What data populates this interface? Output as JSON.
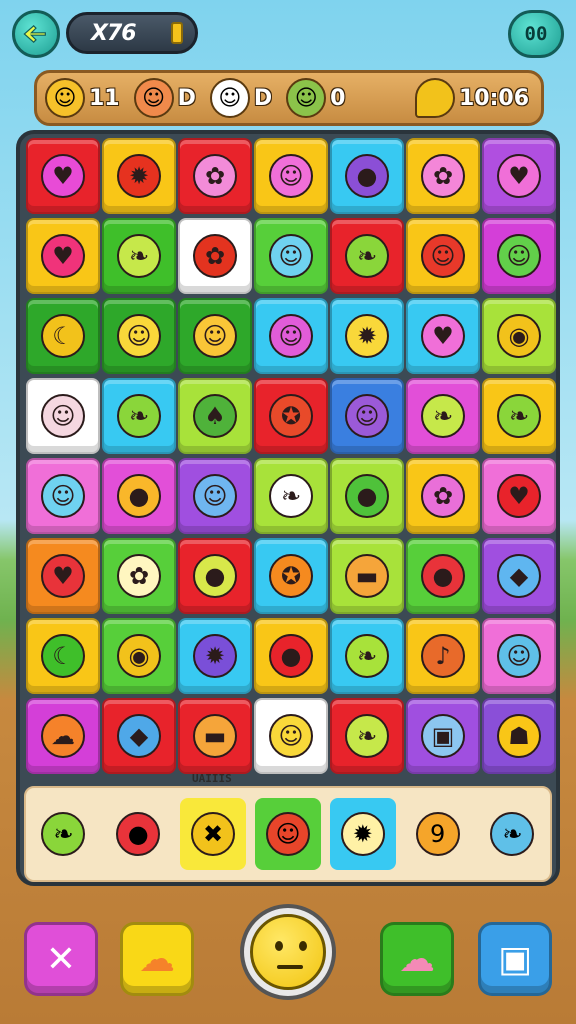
{
  "header": {
    "moves": "X76",
    "pause_label": "00"
  },
  "scorebar": {
    "stats": [
      {
        "icon": "smiley-face-icon",
        "value": "11",
        "color": "#f6c12a"
      },
      {
        "icon": "girl-face-icon",
        "value": "D",
        "color": "#f08a4b"
      },
      {
        "icon": "ghost-icon",
        "value": "D",
        "color": "#ffffff"
      },
      {
        "icon": "turtle-icon",
        "value": "0",
        "color": "#8bc34a"
      }
    ],
    "timer": {
      "icon": "banana-icon",
      "value": "10:06",
      "color": "#f2c21b"
    }
  },
  "board": {
    "rows": [
      [
        {
          "bg": "#e8232b",
          "fg": "#e84bd6",
          "g": "♥"
        },
        {
          "bg": "#f9c617",
          "fg": "#e6321f",
          "g": "✹"
        },
        {
          "bg": "#e8232b",
          "fg": "#f28bd8",
          "g": "✿"
        },
        {
          "bg": "#f9c617",
          "fg": "#f06fd8",
          "g": "☺"
        },
        {
          "bg": "#38c9f2",
          "fg": "#8b4fd6",
          "g": "●"
        },
        {
          "bg": "#f9c617",
          "fg": "#f486d8",
          "g": "✿"
        },
        {
          "bg": "#b04fe0",
          "fg": "#f06fd8",
          "g": "♥"
        }
      ],
      [
        {
          "bg": "#f9c617",
          "fg": "#f0337a",
          "g": "♥"
        },
        {
          "bg": "#3fbf2a",
          "fg": "#c6e84a",
          "g": "❧"
        },
        {
          "bg": "#ffffff",
          "fg": "#e3331f",
          "g": "✿"
        },
        {
          "bg": "#57cf3a",
          "fg": "#6fd2f0",
          "g": "☺"
        },
        {
          "bg": "#e8232b",
          "fg": "#8ad63a",
          "g": "❧"
        },
        {
          "bg": "#f9c617",
          "fg": "#e8392a",
          "g": "☺"
        },
        {
          "bg": "#d43fd8",
          "fg": "#62d04a",
          "g": "☺"
        }
      ],
      [
        {
          "bg": "#2ea82a",
          "fg": "#f2c21b",
          "g": "☾"
        },
        {
          "bg": "#2ea82a",
          "fg": "#f9d83a",
          "g": "☺"
        },
        {
          "bg": "#2ea82a",
          "fg": "#f9c637",
          "g": "☺"
        },
        {
          "bg": "#38c9f2",
          "fg": "#e15cd8",
          "g": "☺"
        },
        {
          "bg": "#38c9f2",
          "fg": "#f9d83a",
          "g": "✹"
        },
        {
          "bg": "#38c9f2",
          "fg": "#f06fd8",
          "g": "♥"
        },
        {
          "bg": "#a8e23a",
          "fg": "#f2c21b",
          "g": "◉"
        }
      ],
      [
        {
          "bg": "#ffffff",
          "fg": "#f5d7e0",
          "g": "☺"
        },
        {
          "bg": "#38c9f2",
          "fg": "#8ad63a",
          "g": "❧"
        },
        {
          "bg": "#a8e23a",
          "fg": "#4fb23a",
          "g": "♠"
        },
        {
          "bg": "#e8232b",
          "fg": "#e84a2a",
          "g": "✪"
        },
        {
          "bg": "#3a7fe0",
          "fg": "#9b5ad8",
          "g": "☺"
        },
        {
          "bg": "#e24fd8",
          "fg": "#c6e84a",
          "g": "❧"
        },
        {
          "bg": "#f9c617",
          "fg": "#8ad63a",
          "g": "❧"
        }
      ],
      [
        {
          "bg": "#f06fd8",
          "fg": "#6fd2f0",
          "g": "☺"
        },
        {
          "bg": "#e24fd8",
          "fg": "#f9b72a",
          "g": "●"
        },
        {
          "bg": "#a04fe0",
          "fg": "#6fb6f0",
          "g": "☺"
        },
        {
          "bg": "#a8e23a",
          "fg": "#ffffff",
          "g": "❧"
        },
        {
          "bg": "#a8e23a",
          "fg": "#4fc23a",
          "g": "●"
        },
        {
          "bg": "#f9c617",
          "fg": "#e96fd8",
          "g": "✿"
        },
        {
          "bg": "#f06fd8",
          "fg": "#e8232b",
          "g": "♥"
        }
      ],
      [
        {
          "bg": "#f58a1f",
          "fg": "#e8333a",
          "g": "♥"
        },
        {
          "bg": "#57cf3a",
          "fg": "#fff6c0",
          "g": "✿"
        },
        {
          "bg": "#e8232b",
          "fg": "#d8e84a",
          "g": "●"
        },
        {
          "bg": "#38c9f2",
          "fg": "#f58a1f",
          "g": "✪"
        },
        {
          "bg": "#a8e23a",
          "fg": "#f5a53a",
          "g": "▬"
        },
        {
          "bg": "#57cf3a",
          "fg": "#e8333a",
          "g": "●"
        },
        {
          "bg": "#a04fe0",
          "fg": "#5fb6f0",
          "g": "◆"
        }
      ],
      [
        {
          "bg": "#f9c617",
          "fg": "#3fbf2a",
          "g": "☾"
        },
        {
          "bg": "#57cf3a",
          "fg": "#f2c21b",
          "g": "◉"
        },
        {
          "bg": "#38c9f2",
          "fg": "#7a4fd8",
          "g": "✹"
        },
        {
          "bg": "#f9c617",
          "fg": "#e8232b",
          "g": "●"
        },
        {
          "bg": "#38c9f2",
          "fg": "#a8e23a",
          "g": "❧"
        },
        {
          "bg": "#f9c617",
          "fg": "#e86a2a",
          "g": "♪"
        },
        {
          "bg": "#f06fd8",
          "fg": "#5fc0e8",
          "g": "☺"
        }
      ],
      [
        {
          "bg": "#d43fd8",
          "fg": "#f5822a",
          "g": "☁"
        },
        {
          "bg": "#e8232b",
          "fg": "#4fa8e8",
          "g": "◆"
        },
        {
          "bg": "#e8232b",
          "fg": "#f5a53a",
          "g": "▬"
        },
        {
          "bg": "#ffffff",
          "fg": "#f9d83a",
          "g": "☺"
        },
        {
          "bg": "#e8232b",
          "fg": "#c6e84a",
          "g": "❧"
        },
        {
          "bg": "#a04fe0",
          "fg": "#8cc6f0",
          "g": "▣"
        },
        {
          "bg": "#8a4fd8",
          "fg": "#f9c617",
          "g": "☗"
        }
      ]
    ],
    "tray_label": "UAIIIS",
    "tray": [
      {
        "bg": "transparent",
        "fg": "#8ad63a",
        "g": "❧"
      },
      {
        "bg": "transparent",
        "fg": "#e8333a",
        "g": "●"
      },
      {
        "bg": "#f9e83a",
        "fg": "#f2c21b",
        "g": "✖"
      },
      {
        "bg": "#57cf3a",
        "fg": "#e8452a",
        "g": "☺"
      },
      {
        "bg": "#38c9f2",
        "fg": "#fff1a6",
        "g": "✹"
      },
      {
        "bg": "transparent",
        "fg": "#f5a52a",
        "g": "9"
      },
      {
        "bg": "transparent",
        "fg": "#5fc0e8",
        "g": "❧"
      }
    ]
  },
  "bottom": {
    "buttons": [
      {
        "name": "close-button",
        "icon": "close-icon",
        "glyph": "✕",
        "bg": "#e04fd8",
        "fg": "#ffffff"
      },
      {
        "name": "powerup-blob-button",
        "icon": "blob-icon",
        "glyph": "☁",
        "bg": "#f9d817",
        "fg": "#f5822a"
      },
      {
        "name": "powerup-pig-button",
        "icon": "pig-icon",
        "glyph": "☁",
        "bg": "#3fbf2a",
        "fg": "#f48ab6"
      },
      {
        "name": "camera-button",
        "icon": "camera-icon",
        "glyph": "▣",
        "bg": "#3a9fe8",
        "fg": "#ffffff"
      }
    ]
  }
}
